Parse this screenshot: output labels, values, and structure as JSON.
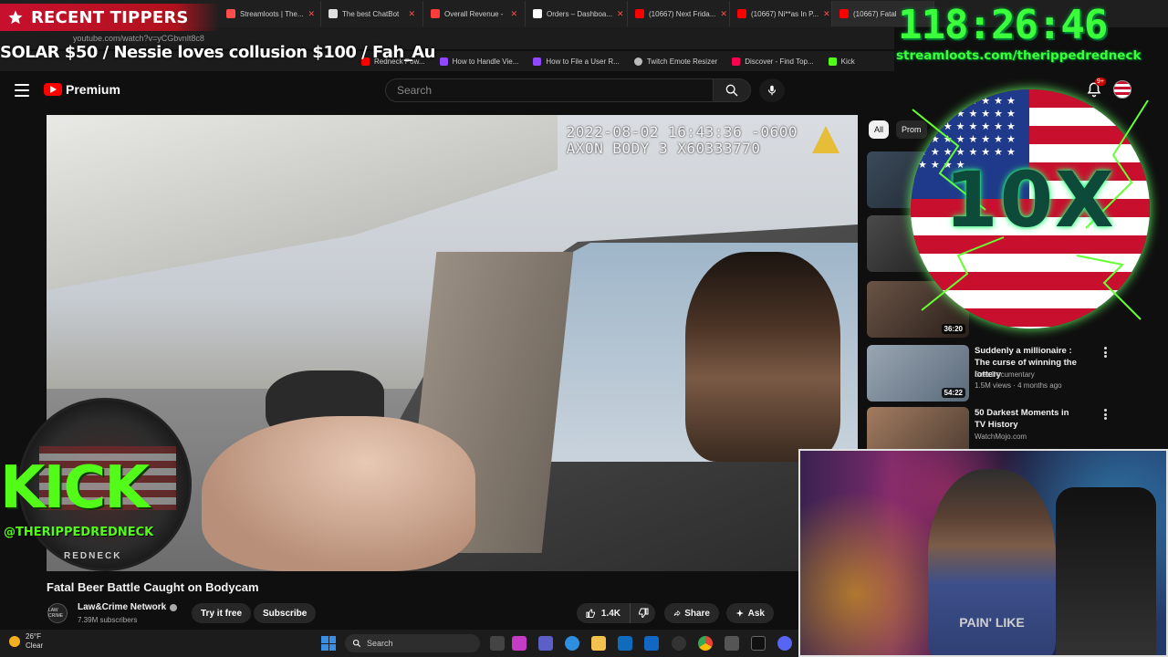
{
  "browser": {
    "tabs": [
      {
        "label": "Streamloots | The...",
        "color": "#ff4d4d"
      },
      {
        "label": "The best ChatBot",
        "color": "#e0e0e0"
      },
      {
        "label": "Overall Revenue -",
        "color": "#ff3b3b"
      },
      {
        "label": "Orders – Dashboa...",
        "color": "#ffffff"
      },
      {
        "label": "(10667) Next Frida...",
        "color": "#ff0000"
      },
      {
        "label": "(10667) Ni**as In P...",
        "color": "#ff0000"
      },
      {
        "label": "(10667) Fatal",
        "color": "#ff0000"
      }
    ],
    "address": "youtube.com/watch?v=yCGbvnlt8c8",
    "bookmarks": [
      {
        "label": "Redneck Pow...",
        "color": "#ff0000"
      },
      {
        "label": "How to Handle Vie...",
        "color": "#9146ff"
      },
      {
        "label": "How to File a User R...",
        "color": "#9146ff"
      },
      {
        "label": "Twitch Emote Resizer",
        "color": "#bbbbbb"
      },
      {
        "label": "Discover - Find Top...",
        "color": "#ff0050"
      },
      {
        "label": "Kick",
        "color": "#53fc18"
      }
    ]
  },
  "overlay": {
    "tippers_title": "RECENT TIPPERS",
    "ticker": "SOLAR $50 / Nessie loves collusion $100 / Fah_Au",
    "timer": "118:26:46",
    "timer_url": "streamloots.com/therippedredneck",
    "tenx_label": "10X",
    "kick_word": "KICK",
    "kick_handle": "@THERIPPEDREDNECK",
    "kick_bottom": "REDNECK",
    "webcam_shirt_text": "PAIN' LIKE"
  },
  "youtube": {
    "brand_label": "Premium",
    "search_placeholder": "Search",
    "notification_count": "9+",
    "video": {
      "timestamp_line1": "2022-08-02 16:43:36 -0600",
      "timestamp_line2": "AXON BODY 3 X60333770",
      "title": "Fatal Beer Battle Caught on Bodycam",
      "channel": "Law&Crime Network",
      "channel_avatar_text": "LAW CRIME",
      "subscribers": "7.39M subscribers",
      "try_label": "Try it free",
      "subscribe_label": "Subscribe",
      "likes": "1.4K",
      "share_label": "Share",
      "ask_label": "Ask"
    },
    "chips": [
      "All",
      "Prom"
    ],
    "recommendations": [
      {
        "title": "",
        "channel": "",
        "meta": "",
        "duration": ""
      },
      {
        "title": "",
        "channel": "",
        "meta": "",
        "duration": ""
      },
      {
        "title": "",
        "channel": "",
        "meta": "",
        "duration": "36:20"
      },
      {
        "title": "Suddenly a millionaire : The curse of winning the lottery",
        "channel": "Best Documentary",
        "meta": "1.5M views · 4 months ago",
        "duration": "54:22"
      },
      {
        "title": "50 Darkest Moments in TV History",
        "channel": "WatchMojo.com",
        "meta": "",
        "duration": ""
      }
    ]
  },
  "taskbar": {
    "temperature": "26°F",
    "condition": "Clear",
    "search_label": "Search"
  }
}
